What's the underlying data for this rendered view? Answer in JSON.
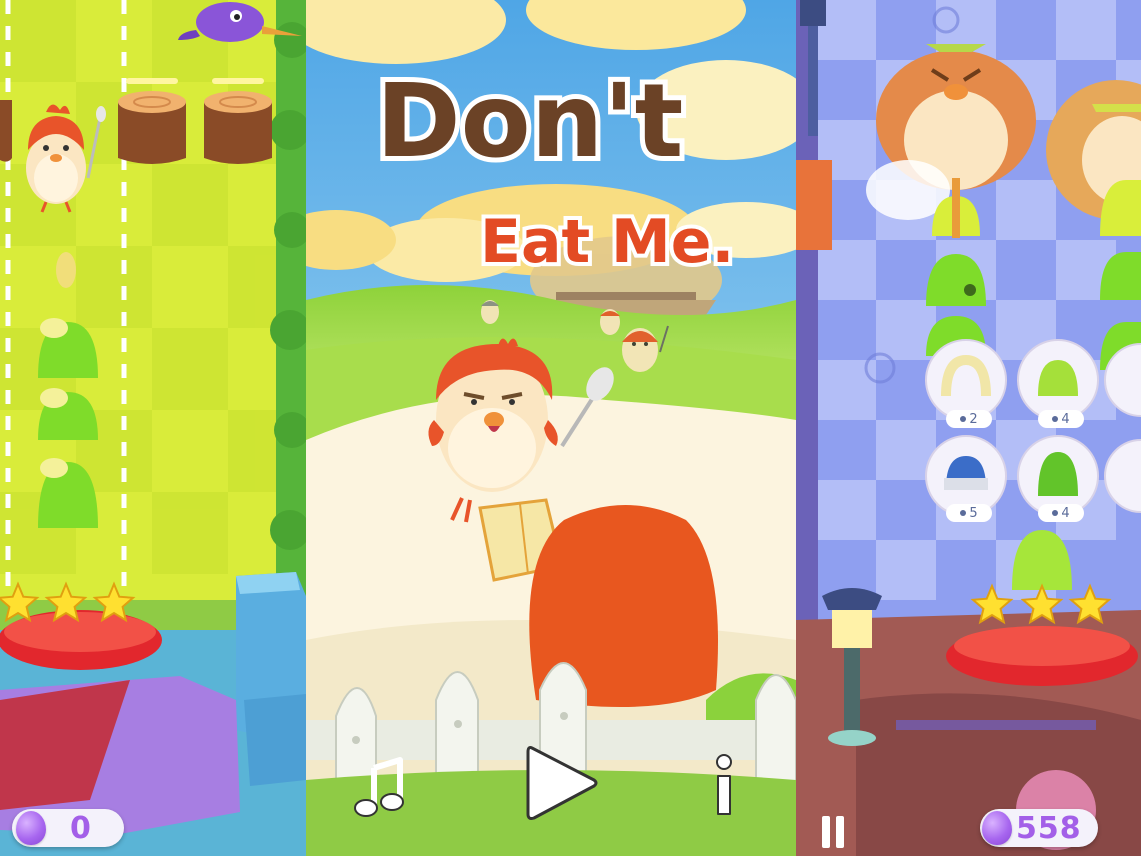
{
  "title": {
    "line1": "Don't",
    "line2": "Eat Me."
  },
  "menu": {
    "music_icon": "music-note-icon",
    "play_icon": "play-icon",
    "info_icon": "info-icon"
  },
  "left_screen": {
    "coins": "0",
    "stars_earned": 3,
    "stars_total": 3
  },
  "right_screen": {
    "coins": "558",
    "stars_earned": 3,
    "stars_total": 3,
    "unit_slots": [
      {
        "count": "2"
      },
      {
        "count": "4"
      },
      {
        "count": "5"
      },
      {
        "count": "4"
      }
    ]
  },
  "colors": {
    "accent_red": "#e8542a",
    "gem_purple": "#a766ef",
    "star_yellow": "#ffe030",
    "grass_green": "#9ed63c"
  }
}
